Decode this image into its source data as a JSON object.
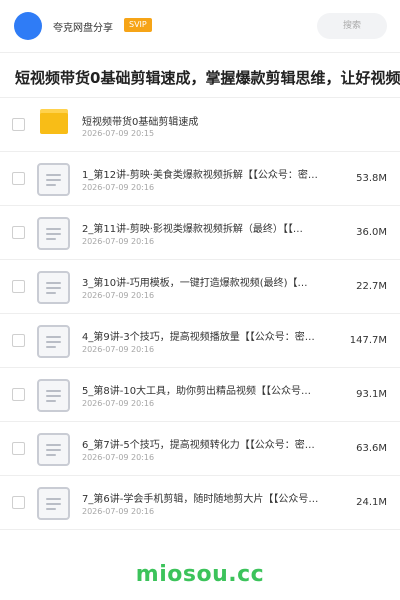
{
  "header": {
    "brand": "夸克网盘分享",
    "badge": "SVIP",
    "search_placeholder": "搜索"
  },
  "page_title": "短视频带货0基础剪辑速成，掌握爆款剪辑思维，让好视频",
  "folder": {
    "name": "短视频带货0基础剪辑速成",
    "date": "2026-07-09 20:15"
  },
  "files": [
    {
      "name": "1_第12讲-剪映·美食类爆款视频拆解【【公众号：密…",
      "date": "2026-07-09 20:16",
      "size": "53.8M"
    },
    {
      "name": "2_第11讲-剪映·影视类爆款视频拆解（最终）【【…",
      "date": "2026-07-09 20:16",
      "size": "36.0M"
    },
    {
      "name": "3_第10讲-巧用模板，一键打造爆款视频(最终)【…",
      "date": "2026-07-09 20:16",
      "size": "22.7M"
    },
    {
      "name": "4_第9讲-3个技巧，提高视频播放量【【公众号：密…",
      "date": "2026-07-09 20:16",
      "size": "147.7M"
    },
    {
      "name": "5_第8讲-10大工具，助你剪出精品视频【【公众号…",
      "date": "2026-07-09 20:16",
      "size": "93.1M"
    },
    {
      "name": "6_第7讲-5个技巧，提高视频转化力【【公众号：密…",
      "date": "2026-07-09 20:16",
      "size": "63.6M"
    },
    {
      "name": "7_第6讲-学会手机剪辑，随时随地剪大片【【公众号…",
      "date": "2026-07-09 20:16",
      "size": "24.1M"
    }
  ],
  "footer": {
    "watermark": "miosou.cc"
  },
  "colors": {
    "accent_blue": "#2f7cf6",
    "svip_orange": "#f6a417",
    "folder_yellow": "#f8bd17",
    "watermark_green": "#3cc35b"
  }
}
